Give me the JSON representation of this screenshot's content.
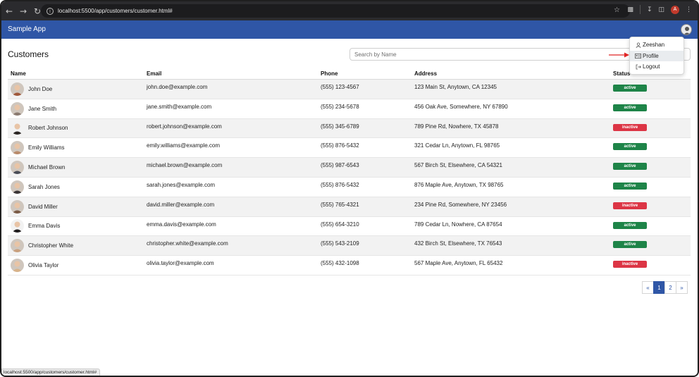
{
  "browser": {
    "url": "localhost:5500/app/customers/customer.html#",
    "profile_initial": "A"
  },
  "app": {
    "title": "Sample App"
  },
  "page": {
    "title": "Customers",
    "search_placeholder": "Search by Name"
  },
  "table": {
    "columns": [
      "Name",
      "Email",
      "Phone",
      "Address",
      "Status"
    ],
    "rows": [
      {
        "name": "John Doe",
        "email": "john.doe@example.com",
        "phone": "(555) 123-4567",
        "address": "123 Main St, Anytown, CA 12345",
        "status": "active",
        "avatar_color": "#a0573a"
      },
      {
        "name": "Jane Smith",
        "email": "jane.smith@example.com",
        "phone": "(555) 234-5678",
        "address": "456 Oak Ave, Somewhere, NY 67890",
        "status": "active",
        "avatar_color": "#8a7a70"
      },
      {
        "name": "Robert Johnson",
        "email": "robert.johnson@example.com",
        "phone": "(555) 345-6789",
        "address": "789 Pine Rd, Nowhere, TX 45878",
        "status": "inactive",
        "avatar_color": "#2a2523"
      },
      {
        "name": "Emily Williams",
        "email": "emily.williams@example.com",
        "phone": "(555) 876-5432",
        "address": "321 Cedar Ln, Anytown, FL 98765",
        "status": "active",
        "avatar_color": "#b98a6a"
      },
      {
        "name": "Michael Brown",
        "email": "michael.brown@example.com",
        "phone": "(555) 987-6543",
        "address": "567 Birch St, Elsewhere, CA 54321",
        "status": "active",
        "avatar_color": "#4a4d57"
      },
      {
        "name": "Sarah Jones",
        "email": "sarah.jones@example.com",
        "phone": "(555) 876-5432",
        "address": "876 Maple Ave, Anytown, TX 98765",
        "status": "active",
        "avatar_color": "#3b3536"
      },
      {
        "name": "David Miller",
        "email": "david.miller@example.com",
        "phone": "(555) 765-4321",
        "address": "234 Pine Rd, Somewhere, NY 23456",
        "status": "inactive",
        "avatar_color": "#7a5a45"
      },
      {
        "name": "Emma Davis",
        "email": "emma.davis@example.com",
        "phone": "(555) 654-3210",
        "address": "789 Cedar Ln, Nowhere, CA 87654",
        "status": "active",
        "avatar_color": "#1f1c1d"
      },
      {
        "name": "Christopher White",
        "email": "christopher.white@example.com",
        "phone": "(555) 543-2109",
        "address": "432 Birch St, Elsewhere, TX 76543",
        "status": "active",
        "avatar_color": "#c9a07e"
      },
      {
        "name": "Olivia Taylor",
        "email": "olivia.taylor@example.com",
        "phone": "(555) 432-1098",
        "address": "567 Maple Ave, Anytown, FL 65432",
        "status": "inactive",
        "avatar_color": "#d8b38a"
      }
    ]
  },
  "pagination": {
    "prev": "«",
    "pages": [
      "1",
      "2"
    ],
    "current": "1",
    "next": "»"
  },
  "user_menu": {
    "items": [
      {
        "label": "Zeeshan",
        "icon": "user-icon"
      },
      {
        "label": "Profile",
        "icon": "id-card-icon"
      },
      {
        "label": "Logout",
        "icon": "logout-icon"
      }
    ],
    "hovered": "Profile"
  },
  "status_bar": {
    "link": "localhost:5500/app/customers/customer.html#"
  },
  "colors": {
    "header": "#2f56a6",
    "active": "#1e8448",
    "inactive": "#dc3545",
    "annotation": "#e02424"
  }
}
